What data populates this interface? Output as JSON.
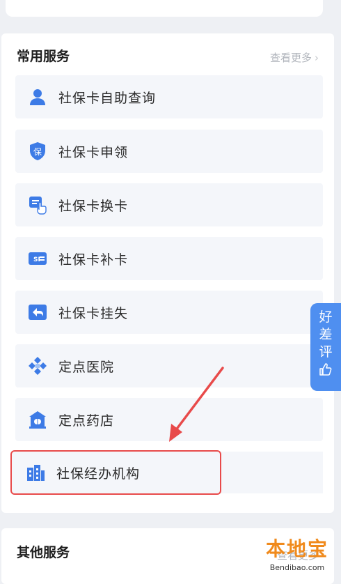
{
  "common": {
    "title": "常用服务",
    "more": "查看更多",
    "items": [
      {
        "label": "社保卡自助查询",
        "icon": "person-icon"
      },
      {
        "label": "社保卡申领",
        "icon": "shield-badge-icon"
      },
      {
        "label": "社保卡换卡",
        "icon": "card-tap-icon"
      },
      {
        "label": "社保卡补卡",
        "icon": "si-card-icon"
      },
      {
        "label": "社保卡挂失",
        "icon": "return-arrow-icon"
      },
      {
        "label": "定点医院",
        "icon": "hospital-cross-icon"
      },
      {
        "label": "定点药店",
        "icon": "pharmacy-icon"
      },
      {
        "label": "社保经办机构",
        "icon": "building-icon"
      }
    ]
  },
  "feedback_tab": {
    "chars": [
      "好",
      "差",
      "评"
    ],
    "icon": "thumbs-up-icon"
  },
  "other": {
    "title": "其他服务",
    "more": "查看更多"
  },
  "watermark": {
    "logo": "本地宝",
    "site": "Bendibao.com"
  },
  "colors": {
    "accent": "#3d7be6",
    "highlight": "#e84a4a",
    "tab": "#4f8ff0"
  }
}
